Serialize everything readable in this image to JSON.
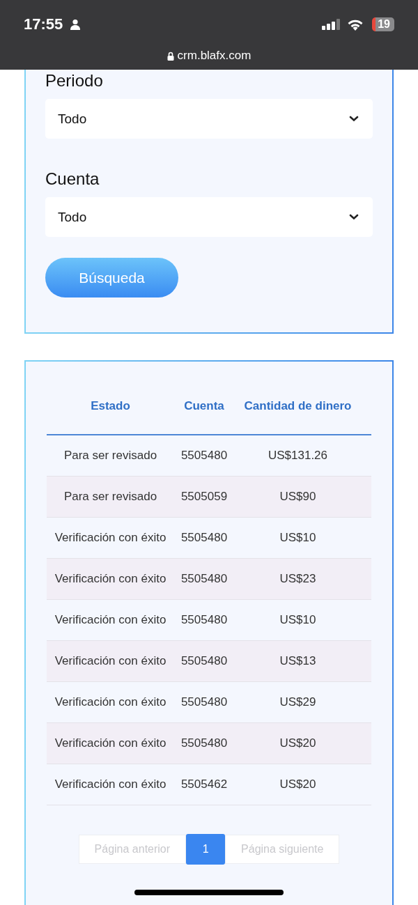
{
  "status_bar": {
    "time": "17:55",
    "battery": "19",
    "url": "crm.blafx.com"
  },
  "filters": [
    {
      "label": "Periodo",
      "value": "Todo"
    },
    {
      "label": "Cuenta",
      "value": "Todo"
    }
  ],
  "search_button": "Búsqueda",
  "table": {
    "columns": [
      "Estado",
      "Cuenta",
      "Cantidad de dinero"
    ],
    "rows": [
      [
        "Para ser revisado",
        "5505480",
        "US$131.26"
      ],
      [
        "Para ser revisado",
        "5505059",
        "US$90"
      ],
      [
        "Verificación con éxito",
        "5505480",
        "US$10"
      ],
      [
        "Verificación con éxito",
        "5505480",
        "US$23"
      ],
      [
        "Verificación con éxito",
        "5505480",
        "US$10"
      ],
      [
        "Verificación con éxito",
        "5505480",
        "US$13"
      ],
      [
        "Verificación con éxito",
        "5505480",
        "US$29"
      ],
      [
        "Verificación con éxito",
        "5505480",
        "US$20"
      ],
      [
        "Verificación con éxito",
        "5505462",
        "US$20"
      ]
    ]
  },
  "pagination": {
    "previous": {
      "label": "Página anterior",
      "disabled": true
    },
    "pages": [
      {
        "label": "1",
        "selected": true
      }
    ],
    "next": {
      "label": "Página siguiente",
      "disabled": true
    }
  }
}
